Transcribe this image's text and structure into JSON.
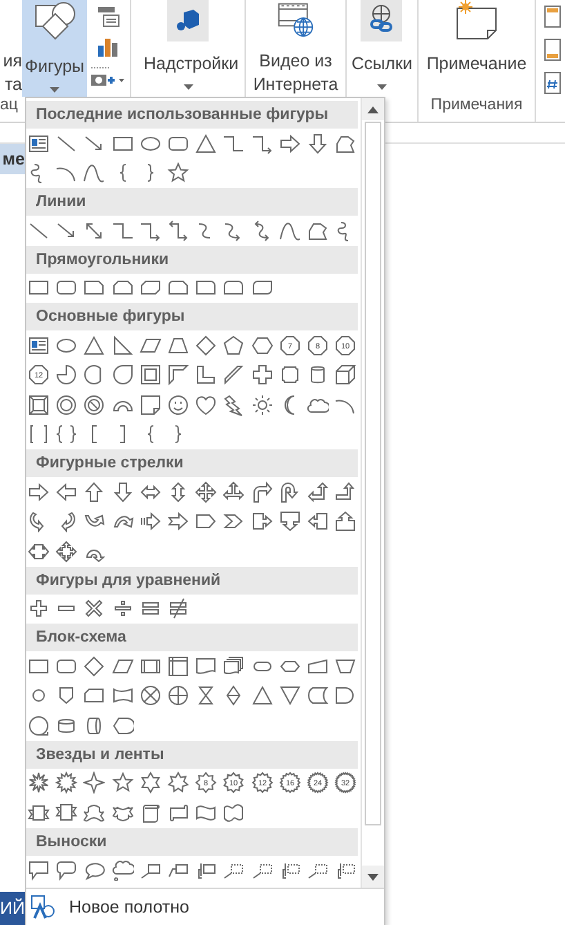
{
  "ribbon": {
    "left_cut_lines": [
      "ия",
      "та"
    ],
    "left_group_label": "ац",
    "shapes_button": {
      "label": "Фигуры",
      "selected": true,
      "dropdown": true
    },
    "buttons": [
      {
        "kind": "addins",
        "label": "Надстройки",
        "dropdown": true
      },
      {
        "kind": "video",
        "label": "Видео из Интернета",
        "dropdown": false
      },
      {
        "kind": "links",
        "label": "Ссылки",
        "dropdown": true
      }
    ],
    "comment_group": {
      "button": "Примечание",
      "label": "Примечания"
    }
  },
  "document": {
    "left_cut_label": "ме"
  },
  "status_bar": {
    "left_cut_label": "ИЙ"
  },
  "gallery": {
    "sections": [
      {
        "title": "Последние использованные фигуры",
        "shapes": [
          {
            "kind": "textbox"
          },
          {
            "kind": "line"
          },
          {
            "kind": "arrow-line"
          },
          {
            "kind": "rect"
          },
          {
            "kind": "oval"
          },
          {
            "kind": "round-rect"
          },
          {
            "kind": "triangle"
          },
          {
            "kind": "elbow-connector"
          },
          {
            "kind": "elbow-arrow"
          },
          {
            "kind": "right-arrow"
          },
          {
            "kind": "down-arrow"
          },
          {
            "kind": "freeform"
          },
          {
            "kind": "scribble"
          },
          {
            "kind": "arc"
          },
          {
            "kind": "curve"
          },
          {
            "kind": "left-brace"
          },
          {
            "kind": "right-brace"
          },
          {
            "kind": "star"
          }
        ]
      },
      {
        "title": "Линии",
        "shapes": [
          {
            "kind": "line"
          },
          {
            "kind": "arrow-line"
          },
          {
            "kind": "double-arrow-line"
          },
          {
            "kind": "elbow-connector"
          },
          {
            "kind": "elbow-arrow"
          },
          {
            "kind": "elbow-double-arrow"
          },
          {
            "kind": "curved-connector"
          },
          {
            "kind": "curved-arrow"
          },
          {
            "kind": "curved-double-arrow"
          },
          {
            "kind": "curve"
          },
          {
            "kind": "freeform"
          },
          {
            "kind": "scribble"
          }
        ]
      },
      {
        "title": "Прямоугольники",
        "shapes": [
          {
            "kind": "rect"
          },
          {
            "kind": "round-rect"
          },
          {
            "kind": "snip-rect"
          },
          {
            "kind": "snip-two-rect"
          },
          {
            "kind": "snip-diagonal-rect"
          },
          {
            "kind": "snip-round-rect"
          },
          {
            "kind": "round-one-rect"
          },
          {
            "kind": "round-two-rect"
          },
          {
            "kind": "round-diagonal-rect"
          }
        ]
      },
      {
        "title": "Основные фигуры",
        "shapes": [
          {
            "kind": "textbox"
          },
          {
            "kind": "oval"
          },
          {
            "kind": "triangle"
          },
          {
            "kind": "right-triangle"
          },
          {
            "kind": "parallelogram"
          },
          {
            "kind": "trapezoid"
          },
          {
            "kind": "diamond"
          },
          {
            "kind": "pentagon"
          },
          {
            "kind": "hexagon"
          },
          {
            "kind": "heptagon",
            "label": "7"
          },
          {
            "kind": "octagon",
            "label": "8"
          },
          {
            "kind": "decagon",
            "label": "10"
          },
          {
            "kind": "dodecagon",
            "label": "12"
          },
          {
            "kind": "pie"
          },
          {
            "kind": "chord"
          },
          {
            "kind": "teardrop"
          },
          {
            "kind": "frame"
          },
          {
            "kind": "half-frame"
          },
          {
            "kind": "l-shape"
          },
          {
            "kind": "diagonal-stripe"
          },
          {
            "kind": "cross"
          },
          {
            "kind": "plaque"
          },
          {
            "kind": "can"
          },
          {
            "kind": "cube"
          },
          {
            "kind": "bevel"
          },
          {
            "kind": "donut"
          },
          {
            "kind": "no-symbol"
          },
          {
            "kind": "block-arc"
          },
          {
            "kind": "folded-corner"
          },
          {
            "kind": "smiley"
          },
          {
            "kind": "heart"
          },
          {
            "kind": "lightning"
          },
          {
            "kind": "sun"
          },
          {
            "kind": "moon"
          },
          {
            "kind": "cloud"
          },
          {
            "kind": "arc"
          },
          {
            "kind": "bracket-pair"
          },
          {
            "kind": "brace-pair"
          },
          {
            "kind": "left-bracket"
          },
          {
            "kind": "right-bracket"
          },
          {
            "kind": "left-brace"
          },
          {
            "kind": "right-brace"
          }
        ]
      },
      {
        "title": "Фигурные стрелки",
        "shapes": [
          {
            "kind": "right-arrow"
          },
          {
            "kind": "left-arrow"
          },
          {
            "kind": "up-arrow"
          },
          {
            "kind": "down-arrow"
          },
          {
            "kind": "left-right-arrow"
          },
          {
            "kind": "up-down-arrow"
          },
          {
            "kind": "quad-arrow"
          },
          {
            "kind": "left-right-up-arrow"
          },
          {
            "kind": "bent-arrow"
          },
          {
            "kind": "u-turn-arrow"
          },
          {
            "kind": "left-up-arrow"
          },
          {
            "kind": "bent-up-arrow"
          },
          {
            "kind": "curved-right-arrow"
          },
          {
            "kind": "curved-left-arrow"
          },
          {
            "kind": "curved-up-arrow"
          },
          {
            "kind": "curved-down-arrow"
          },
          {
            "kind": "striped-arrow"
          },
          {
            "kind": "notched-arrow"
          },
          {
            "kind": "pentagon-arrow"
          },
          {
            "kind": "chevron"
          },
          {
            "kind": "right-arrow-callout"
          },
          {
            "kind": "down-arrow-callout"
          },
          {
            "kind": "left-arrow-callout"
          },
          {
            "kind": "up-arrow-callout"
          },
          {
            "kind": "left-right-arrow-callout"
          },
          {
            "kind": "quad-arrow-callout"
          },
          {
            "kind": "circular-arrow"
          }
        ]
      },
      {
        "title": "Фигуры для уравнений",
        "shapes": [
          {
            "kind": "plus"
          },
          {
            "kind": "minus"
          },
          {
            "kind": "multiply"
          },
          {
            "kind": "divide"
          },
          {
            "kind": "equal"
          },
          {
            "kind": "not-equal"
          }
        ]
      },
      {
        "title": "Блок-схема",
        "shapes": [
          {
            "kind": "rect"
          },
          {
            "kind": "round-rect"
          },
          {
            "kind": "diamond"
          },
          {
            "kind": "parallelogram"
          },
          {
            "kind": "predefined-process"
          },
          {
            "kind": "internal-storage"
          },
          {
            "kind": "document"
          },
          {
            "kind": "multidocument"
          },
          {
            "kind": "terminator"
          },
          {
            "kind": "preparation"
          },
          {
            "kind": "manual-input"
          },
          {
            "kind": "manual-operation"
          },
          {
            "kind": "connector"
          },
          {
            "kind": "off-page-connector"
          },
          {
            "kind": "card"
          },
          {
            "kind": "punched-tape"
          },
          {
            "kind": "summing-junction"
          },
          {
            "kind": "or-junction"
          },
          {
            "kind": "collate"
          },
          {
            "kind": "sort"
          },
          {
            "kind": "extract"
          },
          {
            "kind": "merge"
          },
          {
            "kind": "stored-data"
          },
          {
            "kind": "delay"
          },
          {
            "kind": "sequential-storage"
          },
          {
            "kind": "magnetic-disk"
          },
          {
            "kind": "direct-storage"
          },
          {
            "kind": "display"
          }
        ]
      },
      {
        "title": "Звезды и ленты",
        "shapes": [
          {
            "kind": "burst"
          },
          {
            "kind": "jagged-burst"
          },
          {
            "kind": "four-point-star"
          },
          {
            "kind": "star"
          },
          {
            "kind": "six-point-star"
          },
          {
            "kind": "seven-point-star"
          },
          {
            "kind": "eight-point-star",
            "label": "8"
          },
          {
            "kind": "ten-point-star",
            "label": "10"
          },
          {
            "kind": "twelve-point-star",
            "label": "12"
          },
          {
            "kind": "sixteen-point-star",
            "label": "16"
          },
          {
            "kind": "badge-star",
            "label": "24"
          },
          {
            "kind": "seal-star",
            "label": "32"
          },
          {
            "kind": "up-ribbon"
          },
          {
            "kind": "down-ribbon"
          },
          {
            "kind": "curved-up-ribbon"
          },
          {
            "kind": "curved-down-ribbon"
          },
          {
            "kind": "vertical-scroll"
          },
          {
            "kind": "horizontal-scroll"
          },
          {
            "kind": "wave"
          },
          {
            "kind": "double-wave"
          }
        ]
      },
      {
        "title": "Выноски",
        "shapes": [
          {
            "kind": "rect-callout"
          },
          {
            "kind": "round-rect-callout"
          },
          {
            "kind": "oval-callout"
          },
          {
            "kind": "cloud-callout"
          },
          {
            "kind": "line-callout"
          },
          {
            "kind": "bent-line-callout"
          },
          {
            "kind": "accent-callout"
          },
          {
            "kind": "dotted-line-callout"
          },
          {
            "kind": "dotted-line-callout"
          },
          {
            "kind": "dotted-bent-callout"
          },
          {
            "kind": "dotted-line-callout"
          },
          {
            "kind": "dotted-bent-callout"
          }
        ]
      }
    ],
    "footer": {
      "label": "Новое полотно"
    }
  }
}
